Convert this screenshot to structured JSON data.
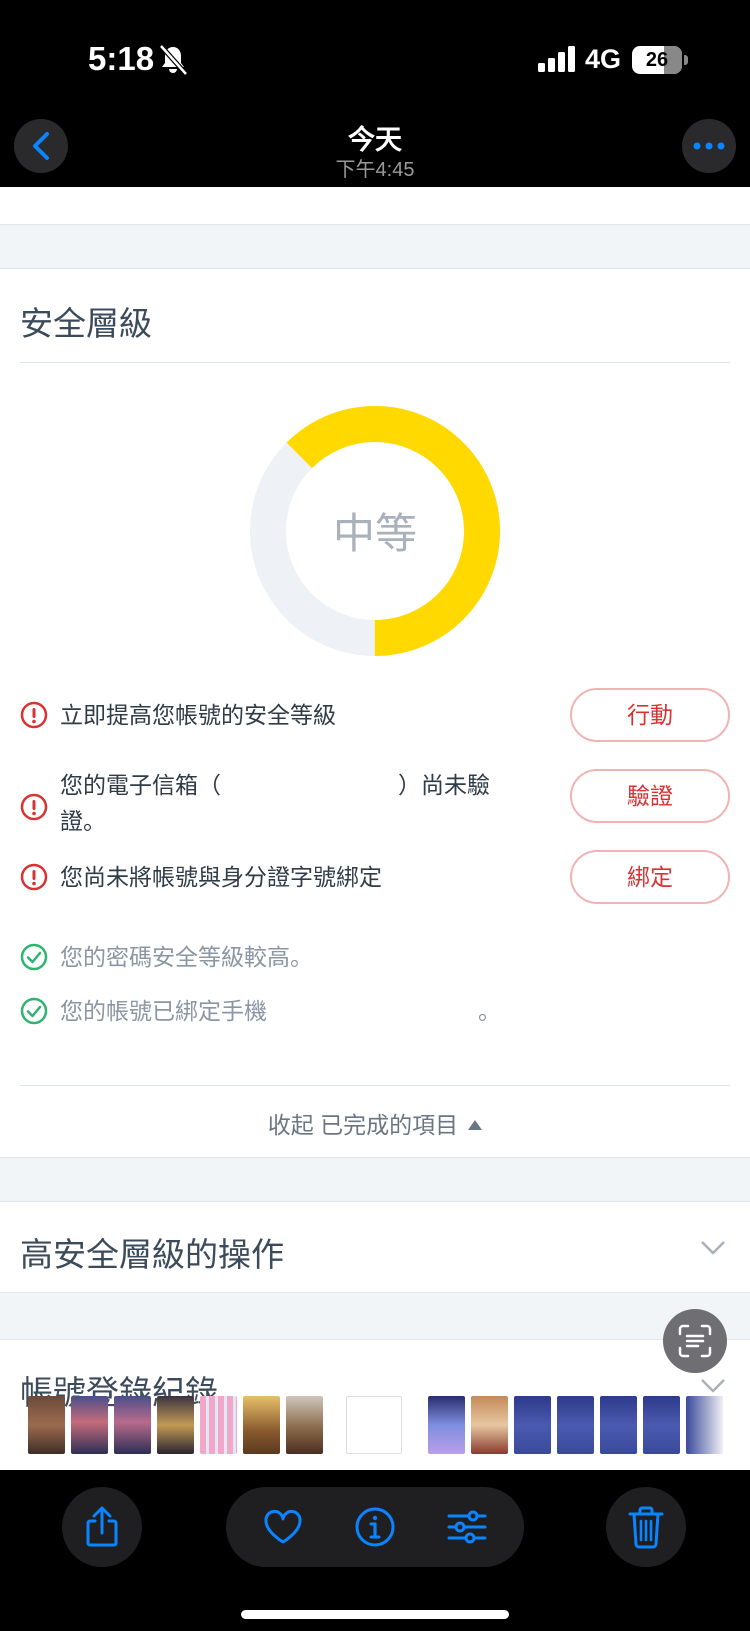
{
  "status_bar": {
    "time": "5:18",
    "network": "4G",
    "battery": "26"
  },
  "nav": {
    "title": "今天",
    "subtitle": "下午4:45"
  },
  "security": {
    "title": "安全層級",
    "level": "中等",
    "level_fraction": 0.625,
    "gauge_fill_color": "#FFD900",
    "gauge_track_color": "#EEF2F6",
    "alerts": [
      {
        "text": "立即提高您帳號的安全等級",
        "button": "行動"
      },
      {
        "text_line1": "您的電子信箱（",
        "text_close": "）尚未驗",
        "text_line2": "證。",
        "button": "驗證"
      },
      {
        "text": "您尚未將帳號與身分證字號綁定",
        "button": "綁定"
      }
    ],
    "completed": [
      {
        "text": "您的密碼安全等級較高。"
      },
      {
        "text": "您的帳號已綁定手機",
        "suffix": "。"
      }
    ],
    "collapse_label": "收起 已完成的項目"
  },
  "sections": [
    {
      "title": "高安全層級的操作"
    },
    {
      "title": "帳號登錄紀錄"
    }
  ],
  "colors": {
    "accent": "#0A84FF",
    "danger": "#D93232",
    "success": "#2DB46F"
  }
}
